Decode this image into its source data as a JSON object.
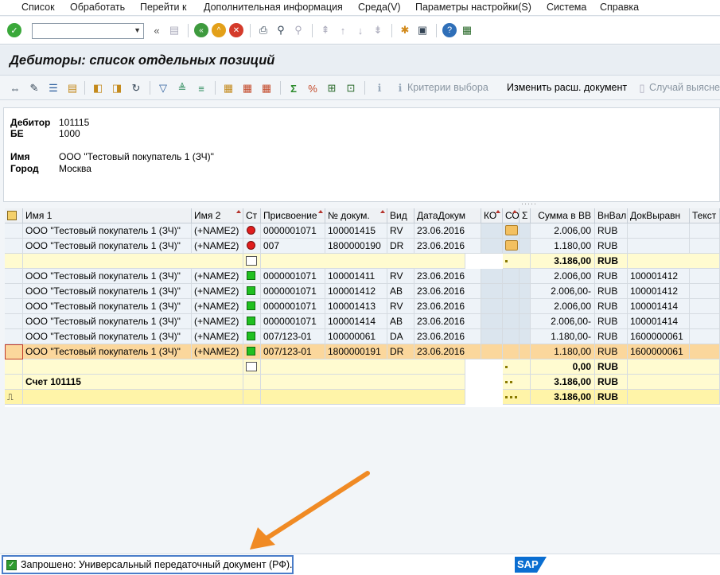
{
  "menu": [
    "Список",
    "Обработать",
    "Перейти к",
    "Дополнительная информация",
    "Среда(V)",
    "Параметры настройки(S)",
    "Система",
    "Справка"
  ],
  "title": "Дебиторы: список отдельных позиций",
  "app_toolbar": {
    "criteria": "Критерии выбора",
    "change_doc": "Изменить расш. документ",
    "dispute": "Случай выяснен"
  },
  "header": {
    "debtor_label": "Дебитор",
    "debtor_value": "101115",
    "be_label": "БЕ",
    "be_value": "1000",
    "name_label": "Имя",
    "name_value": "ООО \"Тестовый покупатель 1 (ЗЧ)\"",
    "city_label": "Город",
    "city_value": "Москва"
  },
  "columns": [
    "Имя 1",
    "Имя 2",
    "Ст",
    "Присвоение",
    "№ докум.",
    "Вид",
    "ДатаДокум",
    "КО",
    "СО",
    "Σ",
    "Сумма в ВВ",
    "ВнВал",
    "ДокВыравн",
    "Текст"
  ],
  "rows_open": [
    {
      "name1": "ООО \"Тестовый покупатель 1 (ЗЧ)\"",
      "name2": "(+NAME2)",
      "assign": "0000001071",
      "doc": "100001415",
      "type": "RV",
      "date": "23.06.2016",
      "amount": "2.006,00",
      "cur": "RUB",
      "clr": ""
    },
    {
      "name1": "ООО \"Тестовый покупатель 1 (ЗЧ)\"",
      "name2": "(+NAME2)",
      "assign": "007",
      "doc": "1800000190",
      "type": "DR",
      "date": "23.06.2016",
      "amount": "1.180,00",
      "cur": "RUB",
      "clr": ""
    }
  ],
  "subtotal_open": {
    "amount": "3.186,00",
    "cur": "RUB"
  },
  "rows_cleared": [
    {
      "name1": "ООО \"Тестовый покупатель 1 (ЗЧ)\"",
      "name2": "(+NAME2)",
      "assign": "0000001071",
      "doc": "100001411",
      "type": "RV",
      "date": "23.06.2016",
      "amount": "2.006,00",
      "cur": "RUB",
      "clr": "100001412"
    },
    {
      "name1": "ООО \"Тестовый покупатель 1 (ЗЧ)\"",
      "name2": "(+NAME2)",
      "assign": "0000001071",
      "doc": "100001412",
      "type": "AB",
      "date": "23.06.2016",
      "amount": "2.006,00-",
      "cur": "RUB",
      "clr": "100001412"
    },
    {
      "name1": "ООО \"Тестовый покупатель 1 (ЗЧ)\"",
      "name2": "(+NAME2)",
      "assign": "0000001071",
      "doc": "100001413",
      "type": "RV",
      "date": "23.06.2016",
      "amount": "2.006,00",
      "cur": "RUB",
      "clr": "100001414"
    },
    {
      "name1": "ООО \"Тестовый покупатель 1 (ЗЧ)\"",
      "name2": "(+NAME2)",
      "assign": "0000001071",
      "doc": "100001414",
      "type": "AB",
      "date": "23.06.2016",
      "amount": "2.006,00-",
      "cur": "RUB",
      "clr": "100001414"
    },
    {
      "name1": "ООО \"Тестовый покупатель 1 (ЗЧ)\"",
      "name2": "(+NAME2)",
      "assign": "007/123-01",
      "doc": "100000061",
      "type": "DA",
      "date": "23.06.2016",
      "amount": "1.180,00-",
      "cur": "RUB",
      "clr": "1600000061"
    },
    {
      "name1": "ООО \"Тестовый покупатель 1 (ЗЧ)\"",
      "name2": "(+NAME2)",
      "assign": "007/123-01",
      "doc": "1800000191",
      "type": "DR",
      "date": "23.06.2016",
      "amount": "1.180,00",
      "cur": "RUB",
      "clr": "1600000061"
    }
  ],
  "subtotal_cleared": {
    "amount": "0,00",
    "cur": "RUB"
  },
  "account_total": {
    "label": "Счет 101115",
    "amount": "3.186,00",
    "cur": "RUB"
  },
  "grand_total": {
    "amount": "3.186,00",
    "cur": "RUB"
  },
  "status": "Запрошено: Универсальный передаточный документ (РФ).",
  "sap_logo": "SAP",
  "colors": {
    "arrow": "#f08a24",
    "status_border": "#4a7dc9",
    "yellow_total": "#fff4a8",
    "selected_row": "#fbd79c"
  }
}
